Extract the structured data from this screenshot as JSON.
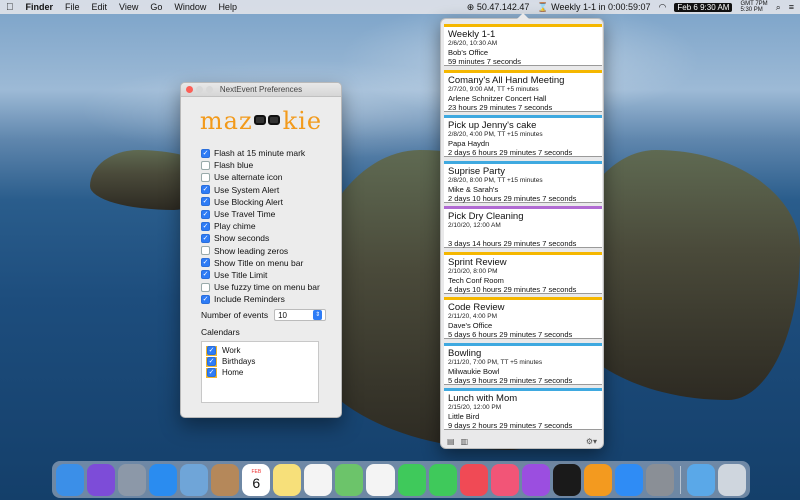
{
  "menubar": {
    "app": "Finder",
    "menus": [
      "File",
      "Edit",
      "View",
      "Go",
      "Window",
      "Help"
    ],
    "ip": "50.47.142.47",
    "next_event": "Weekly 1-1 in 0:00:59:07",
    "date": "Feb 6",
    "time": "9:30 AM",
    "gmt": "GMT 7PM",
    "local2": "5:30 PM"
  },
  "prefs": {
    "title": "NextEvent Preferences",
    "logo_left": "maz",
    "logo_right": "kie",
    "options": [
      {
        "label": "Flash at 15 minute mark",
        "checked": true
      },
      {
        "label": "Flash blue",
        "checked": false
      },
      {
        "label": "Use alternate icon",
        "checked": false
      },
      {
        "label": "Use System Alert",
        "checked": true
      },
      {
        "label": "Use Blocking Alert",
        "checked": true
      },
      {
        "label": "Use Travel Time",
        "checked": true
      },
      {
        "label": "Play chime",
        "checked": true
      },
      {
        "label": "Show seconds",
        "checked": true
      },
      {
        "label": "Show leading zeros",
        "checked": false
      },
      {
        "label": "Show Title on menu bar",
        "checked": true
      },
      {
        "label": "Use Title Limit",
        "checked": true
      },
      {
        "label": "Use fuzzy time on menu bar",
        "checked": false
      },
      {
        "label": "Include Reminders",
        "checked": true
      }
    ],
    "num_events_label": "Number of events",
    "num_events_value": "10",
    "calendars_label": "Calendars",
    "calendars": [
      {
        "name": "Work",
        "checked": true
      },
      {
        "name": "Birthdays",
        "checked": true
      },
      {
        "name": "Home",
        "checked": true
      }
    ]
  },
  "events": [
    {
      "title": "Weekly 1-1",
      "when": "2/6/20, 10:30 AM",
      "location": "Bob's Office",
      "countdown": "59 minutes 7 seconds",
      "color": "#f5b700"
    },
    {
      "title": "Comany's All Hand Meeting",
      "when": "2/7/20, 9:00 AM, TT +5 minutes",
      "location": "Arlene Schnitzer Concert Hall",
      "countdown": "23 hours 29 minutes 7 seconds",
      "color": "#f5b700"
    },
    {
      "title": "Pick up Jenny's cake",
      "when": "2/8/20, 4:00 PM, TT +15 minutes",
      "location": "Papa Haydn",
      "countdown": "2 days 6 hours 29 minutes 7 seconds",
      "color": "#3fa9e0"
    },
    {
      "title": "Suprise Party",
      "when": "2/8/20, 8:00 PM, TT +15 minutes",
      "location": "Mike & Sarah's",
      "countdown": "2 days 10 hours 29 minutes 7 seconds",
      "color": "#3fa9e0"
    },
    {
      "title": "Pick Dry Cleaning",
      "when": "2/10/20, 12:00 AM",
      "location": "",
      "countdown": "3 days 14 hours 29 minutes 7 seconds",
      "color": "#b06ad2"
    },
    {
      "title": "Sprint Review",
      "when": "2/10/20, 8:00 PM",
      "location": "Tech Conf Room",
      "countdown": "4 days 10 hours 29 minutes 7 seconds",
      "color": "#f5b700"
    },
    {
      "title": "Code Review",
      "when": "2/11/20, 4:00 PM",
      "location": "Dave's Office",
      "countdown": "5 days 6 hours 29 minutes 7 seconds",
      "color": "#f5b700"
    },
    {
      "title": "Bowling",
      "when": "2/11/20, 7:00 PM, TT +5 minutes",
      "location": "Milwaukie Bowl",
      "countdown": "5 days 9 hours 29 minutes 7 seconds",
      "color": "#3fa9e0"
    },
    {
      "title": "Lunch with Mom",
      "when": "2/15/20, 12:00 PM",
      "location": "Little Bird",
      "countdown": "9 days 2 hours 29 minutes 7 seconds",
      "color": "#3fa9e0"
    }
  ],
  "dock": {
    "calendar_day": "6",
    "calendar_month": "FEB",
    "apps": [
      {
        "name": "finder-icon",
        "color": "#3b8fe8"
      },
      {
        "name": "siri-icon",
        "color": "#7d4cd8"
      },
      {
        "name": "launchpad-icon",
        "color": "#8c98a8"
      },
      {
        "name": "safari-icon",
        "color": "#2a8cf0"
      },
      {
        "name": "mail-icon",
        "color": "#6fa5d8"
      },
      {
        "name": "contacts-icon",
        "color": "#b5885a"
      },
      {
        "name": "calendar-icon",
        "color": "#ffffff"
      },
      {
        "name": "notes-icon",
        "color": "#f7e07a"
      },
      {
        "name": "reminders-icon",
        "color": "#f4f4f4"
      },
      {
        "name": "maps-icon",
        "color": "#6cc46a"
      },
      {
        "name": "photos-icon",
        "color": "#f4f4f4"
      },
      {
        "name": "messages-icon",
        "color": "#3fc95b"
      },
      {
        "name": "facetime-icon",
        "color": "#3fc95b"
      },
      {
        "name": "news-icon",
        "color": "#f04a55"
      },
      {
        "name": "music-icon",
        "color": "#f25577"
      },
      {
        "name": "podcasts-icon",
        "color": "#9b4ee0"
      },
      {
        "name": "tv-icon",
        "color": "#1a1a1a"
      },
      {
        "name": "books-icon",
        "color": "#f39a1f"
      },
      {
        "name": "appstore-icon",
        "color": "#2f8cf5"
      },
      {
        "name": "system-preferences-icon",
        "color": "#8a8f96"
      }
    ],
    "folders": [
      {
        "name": "downloads-folder-icon",
        "color": "#5aa8e8"
      },
      {
        "name": "trash-icon",
        "color": "#cfd6de"
      }
    ]
  }
}
